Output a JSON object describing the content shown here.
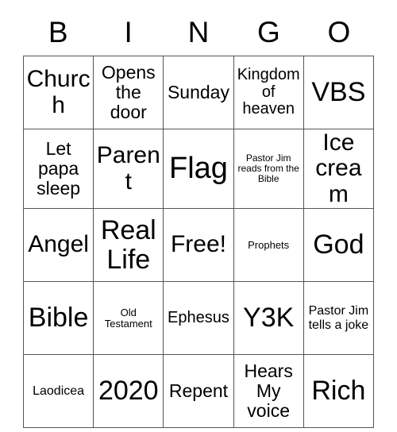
{
  "card": {
    "header_letters": [
      "B",
      "I",
      "N",
      "G",
      "O"
    ],
    "columns": 5,
    "rows": 5,
    "grid_border_color": "#555555",
    "background_color": "#ffffff",
    "text_color": "#000000",
    "cells": [
      [
        {
          "text": "Church",
          "size": "l"
        },
        {
          "text": "Opens the door",
          "size": "m"
        },
        {
          "text": "Sunday",
          "size": "m"
        },
        {
          "text": "Kingdom of heaven",
          "size": "s"
        },
        {
          "text": "VBS",
          "size": "xl"
        }
      ],
      [
        {
          "text": "Let papa sleep",
          "size": "m"
        },
        {
          "text": "Parent",
          "size": "l"
        },
        {
          "text": "Flag",
          "size": "xxl"
        },
        {
          "text": "Pastor Jim reads from the Bible",
          "size": "tiny"
        },
        {
          "text": "Ice cream",
          "size": "l"
        }
      ],
      [
        {
          "text": "Angel",
          "size": "l"
        },
        {
          "text": "Real Life",
          "size": "xl"
        },
        {
          "text": "Free!",
          "size": "l"
        },
        {
          "text": "Prophets",
          "size": "xxs"
        },
        {
          "text": "God",
          "size": "xl"
        }
      ],
      [
        {
          "text": "Bible",
          "size": "xl"
        },
        {
          "text": "Old Testament",
          "size": "xxs"
        },
        {
          "text": "Ephesus",
          "size": "s"
        },
        {
          "text": "Y3K",
          "size": "xl"
        },
        {
          "text": "Pastor Jim tells a joke",
          "size": "xs"
        }
      ],
      [
        {
          "text": "Laodicea",
          "size": "xs"
        },
        {
          "text": "2020",
          "size": "xl"
        },
        {
          "text": "Repent",
          "size": "m"
        },
        {
          "text": "Hears My voice",
          "size": "m"
        },
        {
          "text": "Rich",
          "size": "xl"
        }
      ]
    ]
  }
}
